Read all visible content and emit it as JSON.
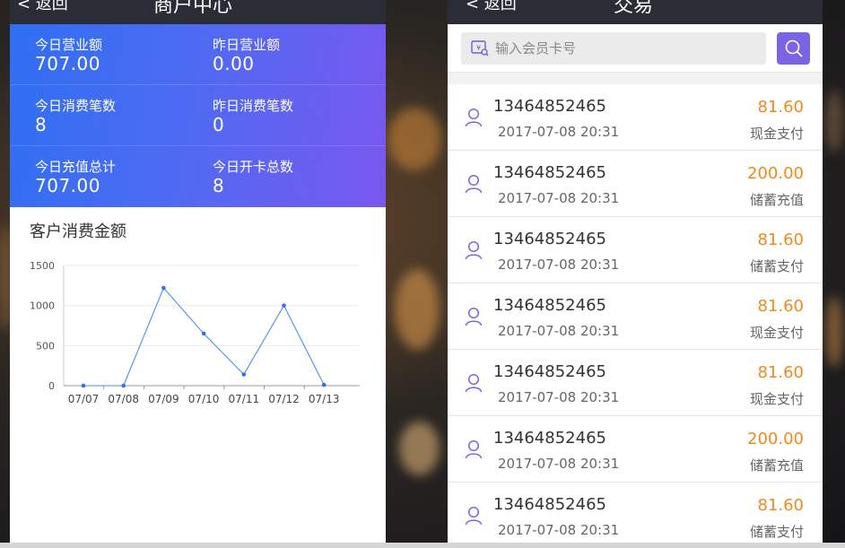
{
  "left_screen": {
    "header": {
      "back_label": "< 返回",
      "title": "商户中心"
    },
    "stats": [
      [
        {
          "label": "今日营业额",
          "value": "707.00"
        },
        {
          "label": "昨日营业额",
          "value": "0.00"
        }
      ],
      [
        {
          "label": "今日消费笔数",
          "value": "8"
        },
        {
          "label": "昨日消费笔数",
          "value": "0"
        }
      ],
      [
        {
          "label": "今日充值总计",
          "value": "707.00"
        },
        {
          "label": "今日开卡总数",
          "value": "8"
        }
      ]
    ],
    "chart_title": "客户消费金额"
  },
  "chart_data": {
    "type": "line",
    "title": "客户消费金额",
    "categories": [
      "07/07",
      "07/08",
      "07/09",
      "07/10",
      "07/11",
      "07/12",
      "07/13"
    ],
    "values": [
      0,
      0,
      1220,
      650,
      140,
      1000,
      10
    ],
    "yticks": [
      0,
      500,
      1000,
      1500
    ],
    "ylim": [
      0,
      1500
    ],
    "grid": true,
    "line_color": "#4a8ef0"
  },
  "right_screen": {
    "header": {
      "back_label": "< 返回",
      "title": "交易"
    },
    "search": {
      "placeholder": "输入会员卡号",
      "value": ""
    },
    "transactions": [
      {
        "phone": "13464852465",
        "date": "2017-07-08 20:31",
        "amount": "81.60",
        "method": "现金支付"
      },
      {
        "phone": "13464852465",
        "date": "2017-07-08 20:31",
        "amount": "200.00",
        "method": "储蓄充值"
      },
      {
        "phone": "13464852465",
        "date": "2017-07-08 20:31",
        "amount": "81.60",
        "method": "储蓄支付"
      },
      {
        "phone": "13464852465",
        "date": "2017-07-08 20:31",
        "amount": "81.60",
        "method": "现金支付"
      },
      {
        "phone": "13464852465",
        "date": "2017-07-08 20:31",
        "amount": "81.60",
        "method": "现金支付"
      },
      {
        "phone": "13464852465",
        "date": "2017-07-08 20:31",
        "amount": "200.00",
        "method": "储蓄充值"
      },
      {
        "phone": "13464852465",
        "date": "2017-07-08 20:31",
        "amount": "81.60",
        "method": "储蓄支付"
      }
    ]
  },
  "colors": {
    "accent": "#7b63e6",
    "amount": "#f08a1c",
    "topbar": "#2b2d36"
  }
}
